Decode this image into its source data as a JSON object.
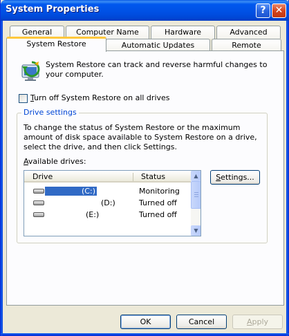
{
  "window": {
    "title": "System Properties",
    "help_button": "?",
    "close_button": "✕"
  },
  "tabs_back": [
    "General",
    "Computer Name",
    "Hardware",
    "Advanced"
  ],
  "tabs_front": [
    "System Restore",
    "Automatic Updates",
    "Remote"
  ],
  "active_tab": "System Restore",
  "panel": {
    "intro_text": "System Restore can track and reverse harmful changes to your computer.",
    "turn_off_checkbox": {
      "label_prefix": "T",
      "label_rest": "urn off System Restore on all drives",
      "checked": false
    },
    "drive_settings": {
      "group_title": "Drive settings",
      "description": "To change the status of System Restore or the maximum amount of disk space available to System Restore on a drive, select the drive, and then click Settings.",
      "available_label_prefix": "A",
      "available_label_rest": "vailable drives:",
      "columns": [
        "Drive",
        "Status"
      ],
      "drives": [
        {
          "name": "(C:)",
          "status": "Monitoring",
          "selected": true
        },
        {
          "name": "(D:)",
          "status": "Turned off",
          "selected": false
        },
        {
          "name": "(E:)",
          "status": "Turned off",
          "selected": false
        }
      ],
      "settings_button_prefix": "S",
      "settings_button_rest": "ettings..."
    }
  },
  "buttons": {
    "ok": "OK",
    "cancel": "Cancel",
    "apply_prefix": "A",
    "apply_rest": "pply"
  },
  "colors": {
    "titlebar": "#0054e3",
    "tab_highlight": "#ffc83c",
    "selection": "#316ac5",
    "group_title": "#0046d5"
  },
  "icons": {
    "system_restore": "system-restore-icon",
    "drive": "hard-drive-icon"
  }
}
